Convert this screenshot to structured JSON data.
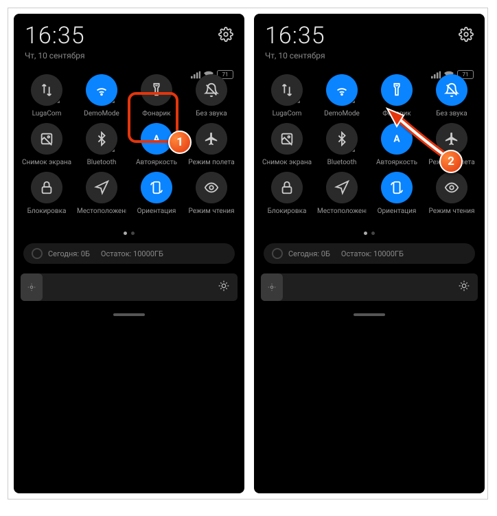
{
  "clock": "16:35",
  "date": "Чт, 10 сентября",
  "battery": "71",
  "tiles": [
    {
      "label": "LugaCom",
      "icon": "data-swap",
      "active": false,
      "expand": true
    },
    {
      "label": "DemoMode",
      "icon": "wifi",
      "active": true,
      "expand": true
    },
    {
      "label": "Фонарик",
      "icon": "flashlight",
      "active": false,
      "expand": false
    },
    {
      "label": "Без звука",
      "icon": "bell-off",
      "active": false,
      "expand": false
    },
    {
      "label": "Снимок экрана",
      "icon": "screenshot",
      "active": false,
      "expand": false
    },
    {
      "label": "Bluetooth",
      "icon": "bluetooth",
      "active": false,
      "expand": true
    },
    {
      "label": "Автояркость",
      "icon": "auto-a",
      "active": true,
      "expand": false
    },
    {
      "label": "Режим полета",
      "icon": "airplane",
      "active": false,
      "expand": false
    },
    {
      "label": "Блокировка",
      "icon": "lock",
      "active": false,
      "expand": false
    },
    {
      "label": "Местоположение",
      "icon": "location",
      "active": false,
      "expand": false
    },
    {
      "label": "Ориентация",
      "icon": "orientation",
      "active": true,
      "expand": false
    },
    {
      "label": "Режим чтения",
      "icon": "eye",
      "active": false,
      "expand": false
    }
  ],
  "tiles2_active": [
    false,
    true,
    true,
    true,
    false,
    false,
    true,
    false,
    false,
    false,
    true,
    false
  ],
  "data_usage": {
    "today": "Сегодня: 0Б",
    "remaining": "Остаток: 10000ГБ"
  },
  "markers": {
    "1": "1",
    "2": "2"
  }
}
